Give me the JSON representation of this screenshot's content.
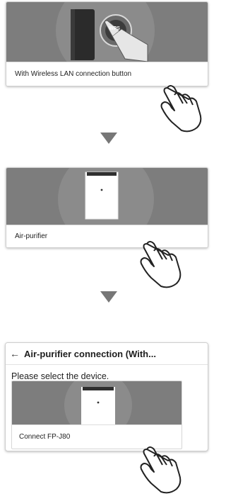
{
  "steps": [
    {
      "card_label": "With Wireless LAN connection button",
      "badge_text": "WPS"
    },
    {
      "card_label": "Air-purifier"
    }
  ],
  "app_screen": {
    "back_icon": "←",
    "title": "Air-purifier connection (With...",
    "prompt": "Please select the device.",
    "device_label": "Connect FP-J80"
  },
  "colors": {
    "photo_bg": "#7d7d7d",
    "arrow": "#777777",
    "card_border": "#cfcfcf"
  },
  "icons": [
    "router-icon",
    "wps-button-icon",
    "air-purifier-icon",
    "pointing-hand-icon",
    "down-arrow-icon",
    "back-arrow-icon"
  ]
}
